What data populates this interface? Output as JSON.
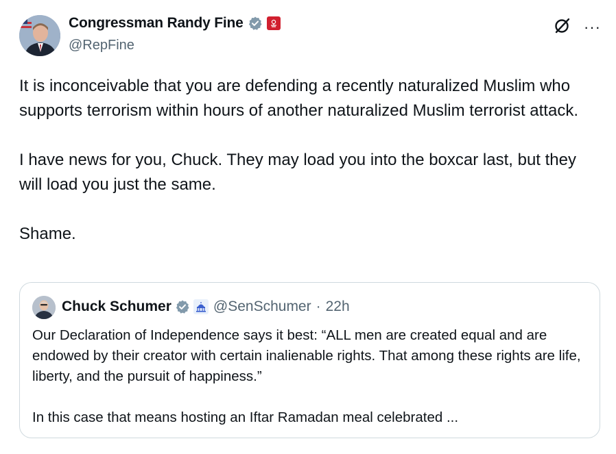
{
  "author": {
    "name": "Congressman Randy Fine",
    "handle": "@RepFine",
    "verified_icon": "verified-badge-icon",
    "affiliation_icon": "us-house-flag-icon"
  },
  "actions": {
    "grok_icon": "grok-icon",
    "more_label": "···"
  },
  "tweet": {
    "paragraphs": [
      "It is inconceivable that you are defending a recently naturalized Muslim who supports terrorism within hours of another naturalized Muslim terrorist attack.",
      "I have news for you, Chuck.  They may load you into the boxcar last, but they will load you just the same.",
      "Shame."
    ]
  },
  "quote": {
    "name": "Chuck Schumer",
    "handle": "@SenSchumer",
    "separator": "·",
    "time": "22h",
    "verified_icon": "verified-badge-icon",
    "affiliation_icon": "us-senate-capitol-icon",
    "paragraphs": [
      "Our Declaration of Independence says it best: “ALL men are created equal and are endowed by their creator with certain inalienable rights. That among these rights are life, liberty, and the pursuit of happiness.”",
      "In this case that means hosting an Iftar Ramadan meal celebrated ..."
    ]
  },
  "colors": {
    "text": "#0f1419",
    "secondary": "#536471",
    "verified": "#829aab",
    "border": "#cfd9de",
    "house_badge": "#d1202f"
  }
}
